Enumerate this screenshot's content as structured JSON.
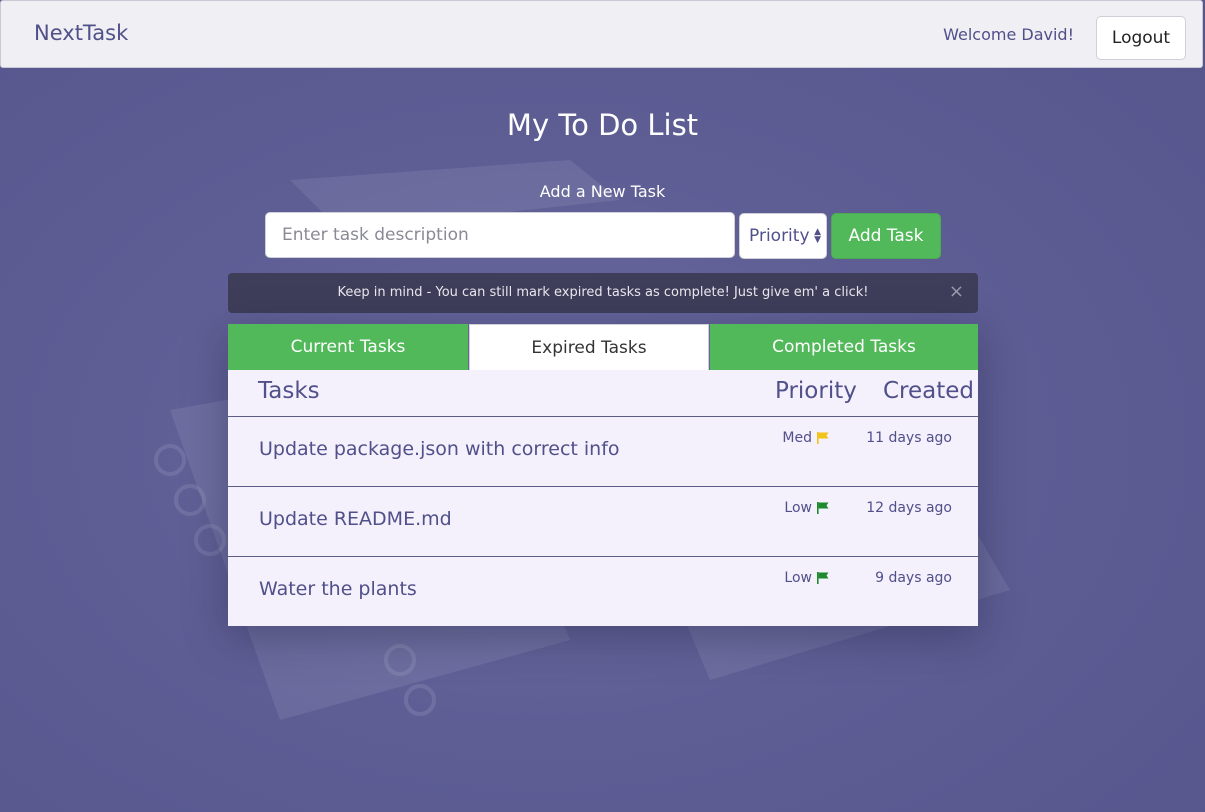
{
  "navbar": {
    "brand": "NextTask",
    "welcome": "Welcome David!",
    "logout_label": "Logout"
  },
  "page": {
    "title": "My To Do List",
    "add_label": "Add a New Task"
  },
  "form": {
    "input_placeholder": "Enter task description",
    "input_value": "",
    "priority_label": "Priority",
    "add_button": "Add Task"
  },
  "alert": {
    "text": "Keep in mind - You can still mark expired tasks as complete! Just give em' a click!",
    "close": "×"
  },
  "tabs": [
    {
      "label": "Current Tasks",
      "active": false
    },
    {
      "label": "Expired Tasks",
      "active": true
    },
    {
      "label": "Completed Tasks",
      "active": false
    }
  ],
  "table": {
    "headers": {
      "tasks": "Tasks",
      "priority": "Priority",
      "created": "Created"
    },
    "rows": [
      {
        "description": "Update package.json with correct info",
        "priority": "Med",
        "flag_color": "#f2c318",
        "created": "11 days ago"
      },
      {
        "description": "Update README.md",
        "priority": "Low",
        "flag_color": "#1e8a2e",
        "created": "12 days ago"
      },
      {
        "description": "Water the plants",
        "priority": "Low",
        "flag_color": "#1e8a2e",
        "created": "9 days ago"
      }
    ]
  },
  "colors": {
    "accent_green": "#52b95a",
    "brand_purple": "#50508a",
    "background": "#5e5e95"
  }
}
